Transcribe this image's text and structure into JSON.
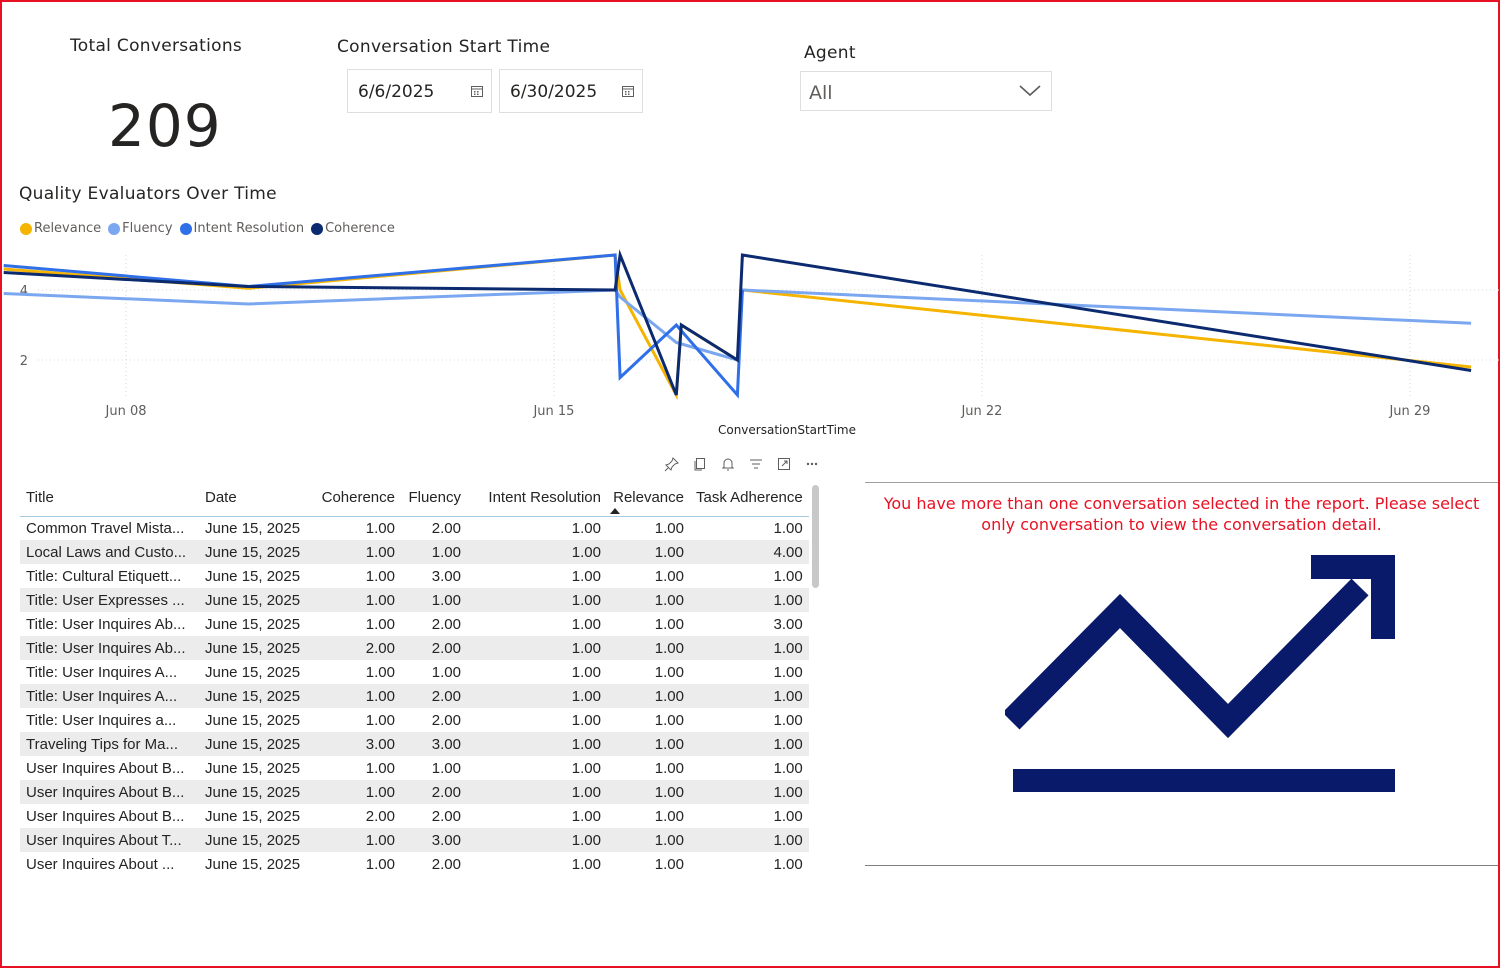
{
  "card": {
    "title": "Total Conversations",
    "value": "209"
  },
  "date_slicer": {
    "title": "Conversation Start Time",
    "start": "6/6/2025",
    "end": "6/30/2025"
  },
  "agent_slicer": {
    "title": "Agent",
    "selected": "All"
  },
  "chart": {
    "title": "Quality Evaluators Over Time"
  },
  "chart_data": {
    "type": "line",
    "title": "Quality Evaluators Over Time",
    "xlabel": "ConversationStartTime",
    "ylabel": "",
    "x_ticks": [
      "Jun 08",
      "Jun 15",
      "Jun 22",
      "Jun 29"
    ],
    "y_ticks": [
      2,
      4
    ],
    "ylim": [
      1,
      5
    ],
    "grid": true,
    "legend_position": "top-left",
    "series": [
      {
        "name": "Relevance",
        "color": "#F5B400",
        "points": [
          [
            "2025-06-06",
            4.6
          ],
          [
            "2025-06-10",
            4.05
          ],
          [
            "2025-06-16",
            5.0
          ],
          [
            "2025-06-16",
            4.0
          ],
          [
            "2025-06-17",
            1.0
          ],
          [
            "2025-06-17",
            3.0
          ],
          [
            "2025-06-18",
            2.0
          ],
          [
            "2025-06-18",
            4.0
          ],
          [
            "2025-06-30",
            1.8
          ]
        ]
      },
      {
        "name": "Fluency",
        "color": "#7BA7F0",
        "points": [
          [
            "2025-06-06",
            3.9
          ],
          [
            "2025-06-10",
            3.6
          ],
          [
            "2025-06-16",
            4.0
          ],
          [
            "2025-06-16",
            3.8
          ],
          [
            "2025-06-17",
            2.5
          ],
          [
            "2025-06-18",
            2.0
          ],
          [
            "2025-06-18",
            4.0
          ],
          [
            "2025-06-30",
            3.05
          ]
        ]
      },
      {
        "name": "Intent Resolution",
        "color": "#2F6FE8",
        "points": [
          [
            "2025-06-06",
            4.7
          ],
          [
            "2025-06-10",
            4.1
          ],
          [
            "2025-06-16",
            5.0
          ],
          [
            "2025-06-16",
            1.5
          ],
          [
            "2025-06-17",
            3.0
          ],
          [
            "2025-06-18",
            1.0
          ],
          [
            "2025-06-18",
            4.0
          ]
        ]
      },
      {
        "name": "Coherence",
        "color": "#0B2A6F",
        "points": [
          [
            "2025-06-06",
            4.5
          ],
          [
            "2025-06-10",
            4.1
          ],
          [
            "2025-06-16",
            4.0
          ],
          [
            "2025-06-16",
            5.0
          ],
          [
            "2025-06-17",
            1.0
          ],
          [
            "2025-06-17",
            3.0
          ],
          [
            "2025-06-18",
            2.0
          ],
          [
            "2025-06-18",
            5.0
          ],
          [
            "2025-06-30",
            1.7
          ]
        ]
      }
    ]
  },
  "table": {
    "columns": [
      "Title",
      "Date",
      "Coherence",
      "Fluency",
      "Intent Resolution",
      "Relevance",
      "Task Adherence"
    ],
    "rows": [
      [
        "Common Travel Mista...",
        "June 15, 2025",
        "1.00",
        "2.00",
        "1.00",
        "1.00",
        "1.00"
      ],
      [
        "Local Laws and Custo...",
        "June 15, 2025",
        "1.00",
        "1.00",
        "1.00",
        "1.00",
        "4.00"
      ],
      [
        "Title: Cultural Etiquett...",
        "June 15, 2025",
        "1.00",
        "3.00",
        "1.00",
        "1.00",
        "1.00"
      ],
      [
        "Title: User Expresses ...",
        "June 15, 2025",
        "1.00",
        "1.00",
        "1.00",
        "1.00",
        "1.00"
      ],
      [
        "Title: User Inquires Ab...",
        "June 15, 2025",
        "1.00",
        "2.00",
        "1.00",
        "1.00",
        "3.00"
      ],
      [
        "Title: User Inquires Ab...",
        "June 15, 2025",
        "2.00",
        "2.00",
        "1.00",
        "1.00",
        "1.00"
      ],
      [
        "Title: User Inquires A...",
        "June 15, 2025",
        "1.00",
        "1.00",
        "1.00",
        "1.00",
        "1.00"
      ],
      [
        "Title: User Inquires A...",
        "June 15, 2025",
        "1.00",
        "2.00",
        "1.00",
        "1.00",
        "1.00"
      ],
      [
        "Title: User Inquires a...",
        "June 15, 2025",
        "1.00",
        "2.00",
        "1.00",
        "1.00",
        "1.00"
      ],
      [
        "Traveling Tips for Ma...",
        "June 15, 2025",
        "3.00",
        "3.00",
        "1.00",
        "1.00",
        "1.00"
      ],
      [
        "User Inquires About B...",
        "June 15, 2025",
        "1.00",
        "1.00",
        "1.00",
        "1.00",
        "1.00"
      ],
      [
        "User Inquires About B...",
        "June 15, 2025",
        "1.00",
        "2.00",
        "1.00",
        "1.00",
        "1.00"
      ],
      [
        "User Inquires About B...",
        "June 15, 2025",
        "2.00",
        "2.00",
        "1.00",
        "1.00",
        "1.00"
      ],
      [
        "User Inquires About T...",
        "June 15, 2025",
        "1.00",
        "3.00",
        "1.00",
        "1.00",
        "1.00"
      ],
      [
        "User Inquires About ...",
        "June 15, 2025",
        "1.00",
        "2.00",
        "1.00",
        "1.00",
        "1.00"
      ]
    ]
  },
  "detail": {
    "message": "You have more than one conversation selected in the report. Please select only conversation to view the conversation detail.",
    "icon": "trend-up-icon",
    "accent": "#0A1A6B",
    "error_color": "#E81123"
  },
  "toolbar_icons": [
    "pin-icon",
    "copy-icon",
    "alert-icon",
    "filter-icon",
    "focus-mode-icon",
    "more-options-icon"
  ]
}
